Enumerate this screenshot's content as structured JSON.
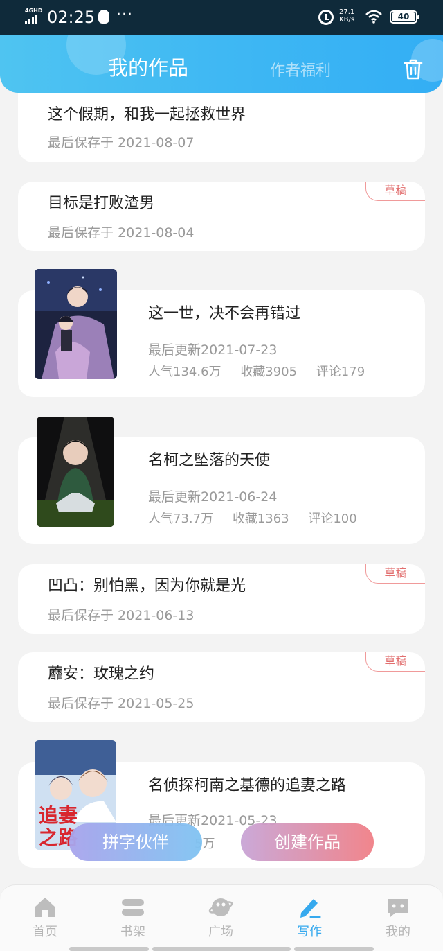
{
  "status_bar": {
    "network": "4GHD",
    "time": "02:25",
    "dots": "···",
    "speed_value": "27.1",
    "speed_unit": "KB/s",
    "battery": "40"
  },
  "header": {
    "tab_my_works": "我的作品",
    "tab_author_welfare": "作者福利",
    "trash_icon": "trash-icon"
  },
  "works": [
    {
      "type": "draft",
      "title": "这个假期，和我一起拯救世界",
      "date_label": "最后保存于 2021-08-07",
      "badge": "草稿"
    },
    {
      "type": "draft",
      "title": "目标是打败渣男",
      "date_label": "最后保存于 2021-08-04",
      "badge": "草稿"
    },
    {
      "type": "published",
      "title": "这一世，决不会再错过",
      "date_label": "最后更新2021-07-23",
      "popularity": "人气134.6万",
      "favorites": "收藏3905",
      "comments": "评论179",
      "cover_icon": "anime-cover-image"
    },
    {
      "type": "published",
      "title": "名柯之坠落的天使",
      "date_label": "最后更新2021-06-24",
      "popularity": "人气73.7万",
      "favorites": "收藏1363",
      "comments": "评论100",
      "cover_icon": "anime-cover-image"
    },
    {
      "type": "draft",
      "title": "凹凸：别怕黑，因为你就是光",
      "date_label": "最后保存于 2021-06-13",
      "badge": "草稿"
    },
    {
      "type": "draft",
      "title": "蘼安：玫瑰之约",
      "date_label": "最后保存于 2021-05-25",
      "badge": "草稿"
    },
    {
      "type": "published",
      "title": "名侦探柯南之基德的追妻之路",
      "date_label": "最后更新2021-05-23",
      "popularity_partial": "5万",
      "cover_text": "追妻之路",
      "cover_icon": "anime-cover-image"
    }
  ],
  "floating_buttons": {
    "partner": "拼字伙伴",
    "create": "创建作品"
  },
  "bottom_nav": [
    {
      "label": "首页",
      "icon": "home-icon",
      "active": false
    },
    {
      "label": "书架",
      "icon": "bookshelf-icon",
      "active": false
    },
    {
      "label": "广场",
      "icon": "planet-icon",
      "active": false
    },
    {
      "label": "写作",
      "icon": "pen-icon",
      "active": true
    },
    {
      "label": "我的",
      "icon": "chat-bubble-icon",
      "active": false
    }
  ],
  "colors": {
    "header_gradient_start": "#4fc4f1",
    "header_gradient_end": "#33aef4",
    "draft_badge": "#e26f6f",
    "nav_active": "#36a9ee",
    "nav_inactive": "#b5b5b5",
    "status_bar": "#0f2a3a"
  }
}
